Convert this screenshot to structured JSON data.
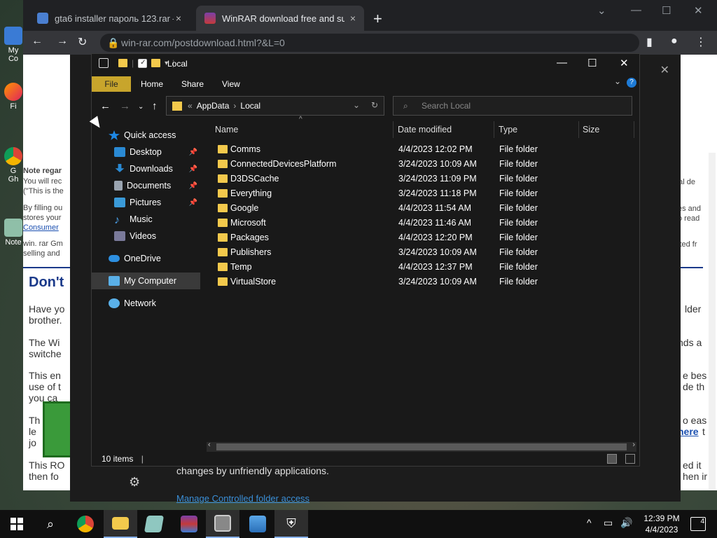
{
  "desktop_icons": [
    "My Co",
    "Fi",
    "G",
    "Gh",
    "Note"
  ],
  "browser": {
    "tabs": [
      {
        "label": "gta6 installer пароль 123.rar — ",
        "close": "×"
      },
      {
        "label": "WinRAR download free and supp",
        "close": "×"
      }
    ],
    "new_tab": "+",
    "url": "win-rar.com/postdownload.html?&L=0",
    "page_fragments": {
      "note": "Note regar",
      "you_will": "You will rec",
      "this_is": "(\"This is the",
      "by_filling": "By filling ou",
      "stores_your": "stores your",
      "consumer": "Consumer",
      "winrar_gm": "win. rar Gm",
      "selling": "selling and",
      "heading": "Don't",
      "have_you": "Have yo",
      "brother": "brother.",
      "the_win": "The Wi",
      "switche": "switche",
      "this_en": "This en",
      "use_of": "use of t",
      "you_can": "you ca",
      "th": "Th",
      "le": "le",
      "jo": "jo",
      "this_ro": "This RO",
      "then_fo": "then fo",
      "right_nal": "nal de",
      "right_es": "es and",
      "right_read": "o read",
      "right_ited": "ited fr",
      "right_older": "lder",
      "right_ds": "nds a",
      "right_bes": "e bes",
      "right_de": "de th",
      "right_eas": "o eas",
      "right_here": "here",
      "right_t": "t",
      "right_edit": "ed it",
      "right_hen": "hen ir"
    }
  },
  "security_panel": {
    "text": "changes by unfriendly applications.",
    "link": "Manage Controlled folder access"
  },
  "explorer": {
    "title": "Local",
    "ribbon_tabs": [
      "File",
      "Home",
      "Share",
      "View"
    ],
    "address": {
      "root_sep": "«",
      "parts": [
        "AppData",
        "Local"
      ]
    },
    "search_placeholder": "Search Local",
    "nav": [
      {
        "label": "Quick access",
        "icon": "star-icon",
        "color": "#1e88e5"
      },
      {
        "label": "Desktop",
        "icon": "desktop-icon",
        "color": "#2a8ad4",
        "pinned": true
      },
      {
        "label": "Downloads",
        "icon": "download-icon",
        "color": "#2a8ad4",
        "pinned": true
      },
      {
        "label": "Documents",
        "icon": "document-icon",
        "color": "#9aa4b0",
        "pinned": true
      },
      {
        "label": "Pictures",
        "icon": "pictures-icon",
        "color": "#3a9ad8",
        "pinned": true
      },
      {
        "label": "Music",
        "icon": "music-icon",
        "color": "#4a9fe8"
      },
      {
        "label": "Videos",
        "icon": "videos-icon",
        "color": "#7a7a9a"
      },
      {
        "label": "OneDrive",
        "icon": "cloud-icon",
        "color": "#2d8fe0"
      },
      {
        "label": "My Computer",
        "icon": "computer-icon",
        "color": "#5ab0e8"
      },
      {
        "label": "Network",
        "icon": "network-icon",
        "color": "#5ab0e8"
      }
    ],
    "columns": [
      "Name",
      "Date modified",
      "Type",
      "Size"
    ],
    "files": [
      {
        "name": "Comms",
        "date": "4/4/2023 12:02 PM",
        "type": "File folder"
      },
      {
        "name": "ConnectedDevicesPlatform",
        "date": "3/24/2023 10:09 AM",
        "type": "File folder"
      },
      {
        "name": "D3DSCache",
        "date": "3/24/2023 11:09 PM",
        "type": "File folder"
      },
      {
        "name": "Everything",
        "date": "3/24/2023 11:18 PM",
        "type": "File folder"
      },
      {
        "name": "Google",
        "date": "4/4/2023 11:54 AM",
        "type": "File folder"
      },
      {
        "name": "Microsoft",
        "date": "4/4/2023 11:46 AM",
        "type": "File folder"
      },
      {
        "name": "Packages",
        "date": "4/4/2023 12:20 PM",
        "type": "File folder"
      },
      {
        "name": "Publishers",
        "date": "3/24/2023 10:09 AM",
        "type": "File folder"
      },
      {
        "name": "Temp",
        "date": "4/4/2023 12:37 PM",
        "type": "File folder"
      },
      {
        "name": "VirtualStore",
        "date": "3/24/2023 10:09 AM",
        "type": "File folder"
      }
    ],
    "status": "10 items"
  },
  "taskbar": {
    "time": "12:39 PM",
    "date": "4/4/2023",
    "notifications": "4"
  },
  "colors": {
    "folder": "#f3c94c",
    "accent": "#c8a52c",
    "link": "#1a4fb0"
  }
}
